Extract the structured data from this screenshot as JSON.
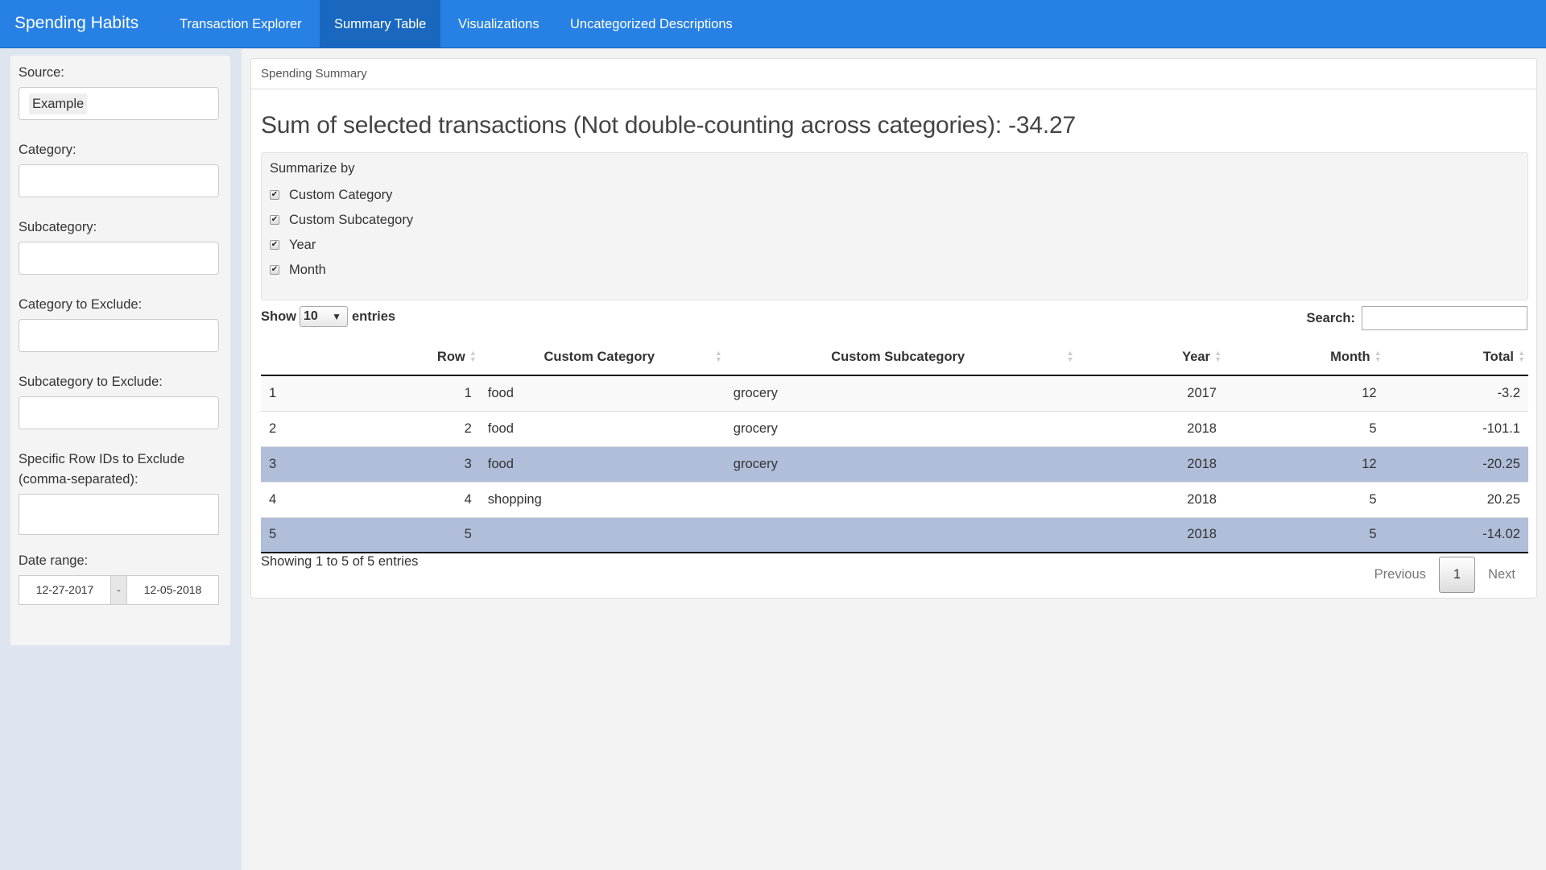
{
  "app": {
    "brand": "Spending Habits",
    "nav": [
      {
        "label": "Transaction Explorer",
        "active": false
      },
      {
        "label": "Summary Table",
        "active": true
      },
      {
        "label": "Visualizations",
        "active": false
      },
      {
        "label": "Uncategorized Descriptions",
        "active": false
      }
    ]
  },
  "sidebar": {
    "source_label": "Source:",
    "source_value": "Example",
    "category_label": "Category:",
    "category_value": "",
    "subcategory_label": "Subcategory:",
    "subcategory_value": "",
    "category_exclude_label": "Category to Exclude:",
    "category_exclude_value": "",
    "subcategory_exclude_label": "Subcategory to Exclude:",
    "subcategory_exclude_value": "",
    "row_ids_label_line1": "Specific Row IDs to Exclude",
    "row_ids_label_line2": "(comma-separated):",
    "row_ids_value": "",
    "date_range_label": "Date range:",
    "date_start": "12-27-2017",
    "date_separator": "-",
    "date_end": "12-05-2018"
  },
  "main": {
    "panel_title": "Spending Summary",
    "sum_text": "Sum of selected transactions (Not double-counting across categories): -34.27",
    "summarize_label": "Summarize by",
    "summarize_options": [
      {
        "label": "Custom Category",
        "checked": true
      },
      {
        "label": "Custom Subcategory",
        "checked": true
      },
      {
        "label": "Year",
        "checked": true
      },
      {
        "label": "Month",
        "checked": true
      }
    ],
    "check_glyph": "✔",
    "length": {
      "show": "Show",
      "value": "10",
      "entries": "entries",
      "caret": "▼"
    },
    "search": {
      "label": "Search:",
      "value": ""
    },
    "table": {
      "columns": [
        "",
        "Row",
        "Custom Category",
        "Custom Subcategory",
        "Year",
        "Month",
        "Total"
      ],
      "rows": [
        {
          "index": "1",
          "row": "1",
          "category": "food",
          "subcategory": "grocery",
          "year": "2017",
          "month": "12",
          "total": "-3.2",
          "selected": false
        },
        {
          "index": "2",
          "row": "2",
          "category": "food",
          "subcategory": "grocery",
          "year": "2018",
          "month": "5",
          "total": "-101.1",
          "selected": false
        },
        {
          "index": "3",
          "row": "3",
          "category": "food",
          "subcategory": "grocery",
          "year": "2018",
          "month": "12",
          "total": "-20.25",
          "selected": true
        },
        {
          "index": "4",
          "row": "4",
          "category": "shopping",
          "subcategory": "",
          "year": "2018",
          "month": "5",
          "total": "20.25",
          "selected": false
        },
        {
          "index": "5",
          "row": "5",
          "category": "",
          "subcategory": "",
          "year": "2018",
          "month": "5",
          "total": "-14.02",
          "selected": true
        }
      ]
    },
    "info": "Showing 1 to 5 of 5 entries",
    "pagination": {
      "previous": "Previous",
      "current": "1",
      "next": "Next"
    },
    "colors": {
      "navbar": "#2780e3",
      "nav_active": "#1967be",
      "row_selected": "#b0bed9",
      "sidebar_bg": "#dee5f0"
    }
  }
}
